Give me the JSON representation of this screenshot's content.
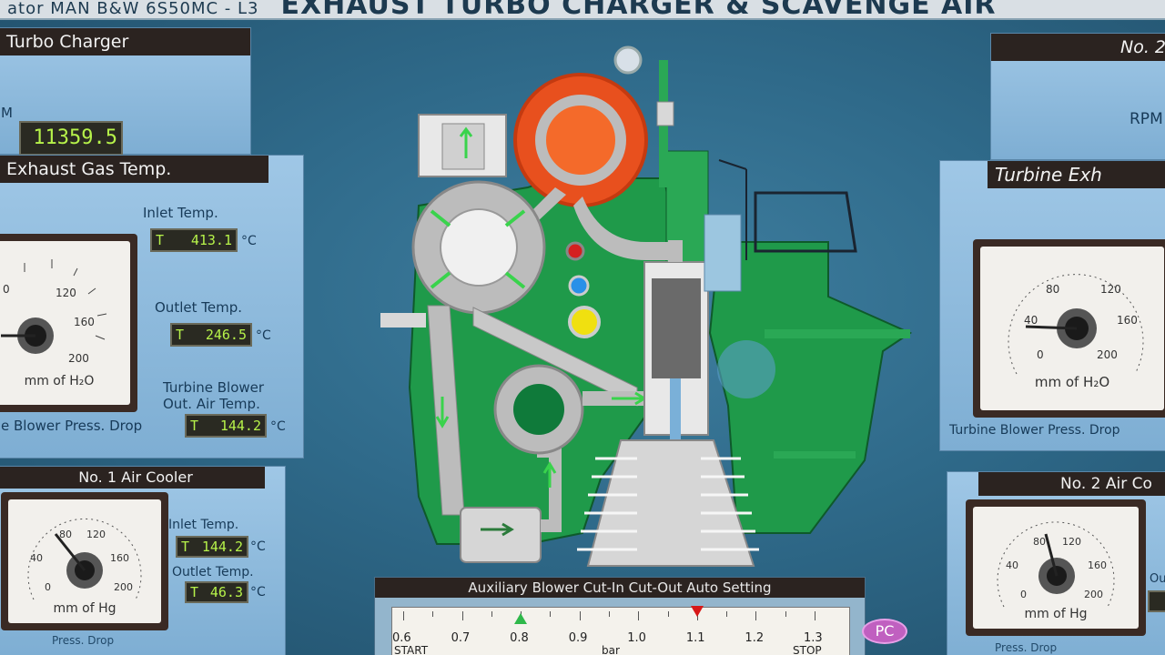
{
  "title": {
    "prefix": "ator MAN B&W 6S50MC - L3",
    "main": "EXHAUST TURBO CHARGER & SCAVENGE AIR"
  },
  "left": {
    "tc_head": "Turbo Charger",
    "rpm_label": "M",
    "rpm_value": "11359.5",
    "exh_head": "Exhaust Gas Temp.",
    "inlet_label": "Inlet Temp.",
    "inlet_prefix": "T",
    "inlet_value": "413.1",
    "outlet_label": "Outlet Temp.",
    "outlet_prefix": "T",
    "outlet_value": "246.5",
    "blower_label_1": "Turbine Blower",
    "blower_label_2": "Out. Air Temp.",
    "blower_prefix": "T",
    "blower_value": "144.2",
    "unit_c": "°C",
    "gauge_unit": "mm of H₂O",
    "press_drop": "e Blower Press. Drop",
    "gauge_ticks": [
      "0",
      "120",
      "160",
      "200"
    ]
  },
  "cooler1": {
    "head": "No. 1 Air Cooler",
    "inlet_label": "Inlet Temp.",
    "inlet_prefix": "T",
    "inlet_value": "144.2",
    "outlet_label": "Outlet Temp.",
    "outlet_prefix": "T",
    "outlet_value": "46.3",
    "unit_c": "°C",
    "gauge_unit": "mm of Hg",
    "gauge_ticks": [
      "40",
      "80",
      "120",
      "160",
      "0",
      "200"
    ],
    "press_drop": "Press. Drop"
  },
  "right": {
    "no2_head": "No. 2",
    "rpm_label": "RPM",
    "turb_head": "Turbine Exh",
    "gauge_unit": "mm of H₂O",
    "gauge_ticks": [
      "40",
      "80",
      "120",
      "160",
      "0",
      "200"
    ],
    "press_drop": "Turbine Blower Press. Drop",
    "cooler2_head": "No. 2 Air Co",
    "cooler2_unit": "mm of Hg",
    "cooler2_ticks": [
      "40",
      "80",
      "120",
      "160",
      "0",
      "200"
    ],
    "cooler2_press": "Press. Drop",
    "side_label": "Ou"
  },
  "blower": {
    "head": "Auxiliary Blower Cut-In Cut-Out Auto Setting",
    "ticks": [
      "0.6",
      "0.7",
      "0.8",
      "0.9",
      "1.0",
      "1.1",
      "1.2",
      "1.3"
    ],
    "start": "START",
    "unit": "bar",
    "stop": "STOP",
    "cut_in": 0.8,
    "cut_out": 1.1
  },
  "pc_label": "PC",
  "colors": {
    "green": "#1f9a4a",
    "orange": "#e8501e",
    "digit": "#b6f24a"
  }
}
